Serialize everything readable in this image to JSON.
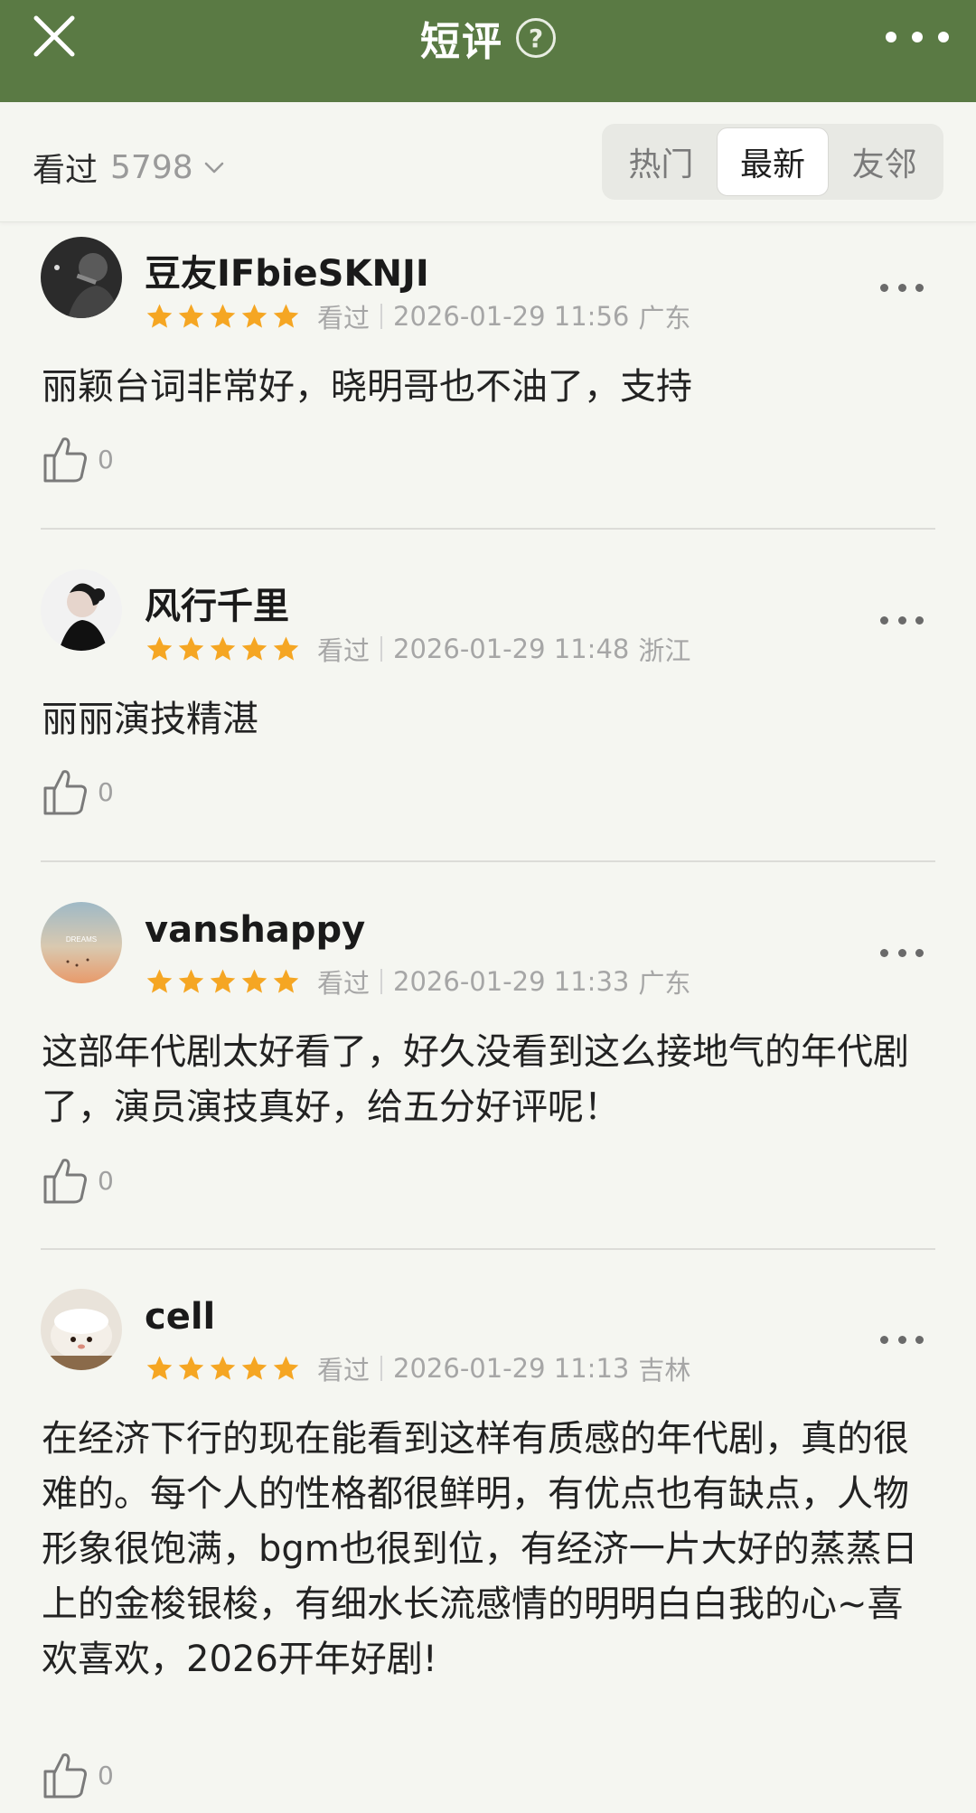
{
  "header": {
    "title": "短评",
    "help_glyph": "?",
    "bg_color": "#5a7a44"
  },
  "filter": {
    "watched_label": "看过",
    "watched_count": "5798",
    "tabs": [
      {
        "label": "热门",
        "active": false
      },
      {
        "label": "最新",
        "active": true
      },
      {
        "label": "友邻",
        "active": false
      }
    ]
  },
  "reviews": [
    {
      "username": "豆友IFbieSKNJI",
      "rating": 5,
      "status": "看过",
      "datetime": "2026-01-29 11:56",
      "location": "广东",
      "text": "丽颖台词非常好，晓明哥也不油了，支持",
      "likes": "0"
    },
    {
      "username": "风行千里",
      "rating": 5,
      "status": "看过",
      "datetime": "2026-01-29 11:48",
      "location": "浙江",
      "text": "丽丽演技精湛",
      "likes": "0"
    },
    {
      "username": "vanshappy",
      "rating": 5,
      "status": "看过",
      "datetime": "2026-01-29 11:33",
      "location": "广东",
      "text": "这部年代剧太好看了，好久没看到这么接地气的年代剧了，演员演技真好，给五分好评呢！",
      "likes": "0",
      "avatar_text": "DREAMS"
    },
    {
      "username": "cell",
      "rating": 5,
      "status": "看过",
      "datetime": "2026-01-29 11:13",
      "location": "吉林",
      "text": "在经济下行的现在能看到这样有质感的年代剧，真的很难的。每个人的性格都很鲜明，有优点也有缺点，人物形象很饱满，bgm也很到位，有经济一片大好的蒸蒸日上的金梭银梭，有细水长流感情的明明白白我的心~喜欢喜欢，2026开年好剧!",
      "likes": "0"
    }
  ],
  "colors": {
    "star": "#f5a623",
    "accent_green": "#5a7a44",
    "muted_text": "#a6a6a6"
  }
}
